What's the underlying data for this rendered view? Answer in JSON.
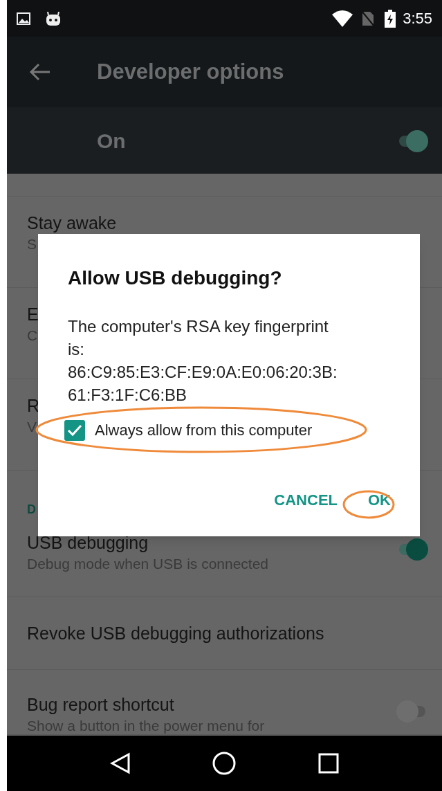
{
  "status_bar": {
    "time": "3:55"
  },
  "toolbar": {
    "title": "Developer options"
  },
  "master_switch": {
    "label": "On",
    "on": true
  },
  "settings": [
    {
      "kind": "row",
      "title": "Stay awake",
      "subtitle": "S"
    },
    {
      "kind": "row",
      "title": "E",
      "subtitle": "C"
    },
    {
      "kind": "row",
      "title": "R",
      "subtitle": "V"
    },
    {
      "kind": "header",
      "title": "D"
    },
    {
      "kind": "switch",
      "title": "USB debugging",
      "subtitle": "Debug mode when USB is connected",
      "on": true
    },
    {
      "kind": "row",
      "title": "Revoke USB debugging authorizations"
    },
    {
      "kind": "switch",
      "title": "Bug report shortcut",
      "subtitle": "Show a button in the power menu for",
      "on": false
    }
  ],
  "dialog": {
    "title": "Allow USB debugging?",
    "message": "The computer's RSA key fingerprint is:\n86:C9:85:E3:CF:E9:0A:E0:06:20:3B:\n61:F3:1F:C6:BB",
    "checkbox": {
      "label": "Always allow from this computer",
      "checked": true
    },
    "buttons": [
      "CANCEL",
      "OK"
    ]
  }
}
